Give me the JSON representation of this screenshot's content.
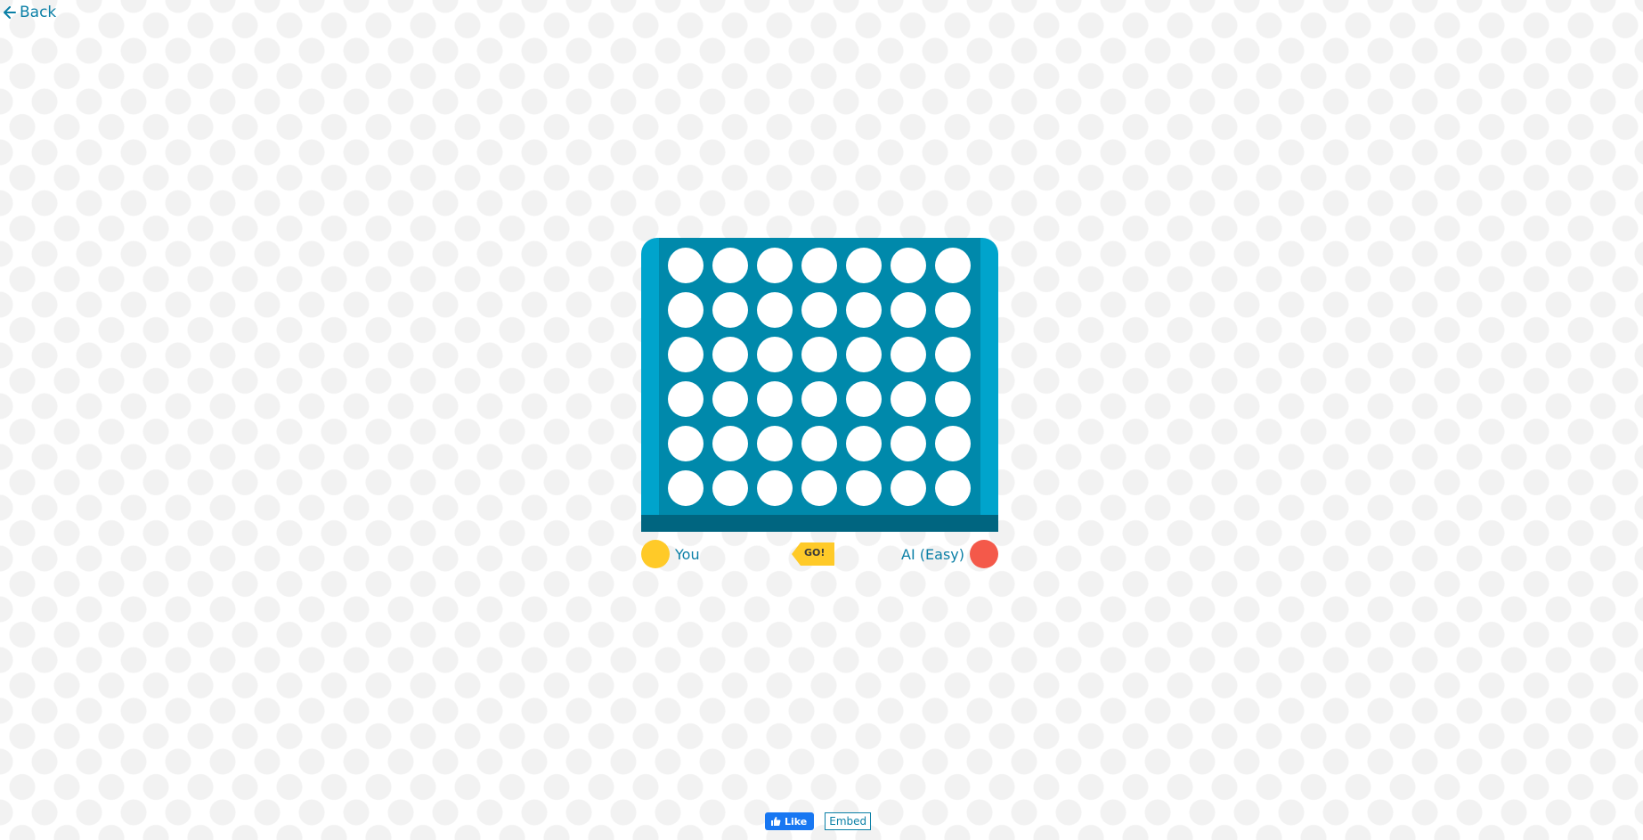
{
  "nav": {
    "back_label": "Back",
    "back_icon": "arrow-left-icon"
  },
  "board": {
    "rows": 6,
    "columns": 7,
    "frame_color": "#00a4cc",
    "inner_color": "#0089ab",
    "base_color": "#006580",
    "empty_slot_color": "#ffffff"
  },
  "players": {
    "you": {
      "label": "You",
      "disc_color": "#ffca28"
    },
    "ai": {
      "label": "AI (Easy)",
      "disc_color": "#f4594a"
    }
  },
  "turn_indicator": {
    "label": "GO!",
    "color": "#ffca28",
    "points_to": "you"
  },
  "footer": {
    "like_label": "Like",
    "like_icon": "thumbs-up-icon",
    "embed_label": "Embed"
  }
}
